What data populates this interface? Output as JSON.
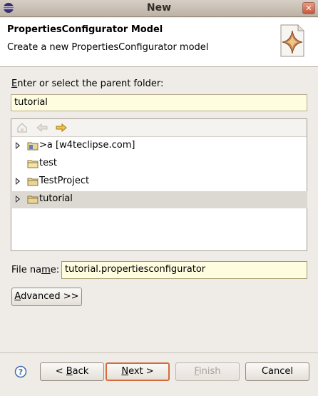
{
  "window": {
    "title": "New"
  },
  "header": {
    "title": "PropertiesConfigurator Model",
    "description": "Create a new PropertiesConfigurator model"
  },
  "parent_folder": {
    "label_mnemonic": "E",
    "label_rest": "nter or select the parent folder:",
    "value": "tutorial"
  },
  "tree": {
    "items": [
      {
        "label": ">a  [w4teclipse.com]",
        "expandable": true
      },
      {
        "label": "test",
        "expandable": false
      },
      {
        "label": "TestProject",
        "expandable": true
      },
      {
        "label": "tutorial",
        "expandable": true,
        "selected": true
      }
    ]
  },
  "file_name": {
    "label_pre": "File na",
    "label_mnemonic": "m",
    "label_post": "e:",
    "value": "tutorial.propertiesconfigurator"
  },
  "buttons": {
    "advanced_mnemonic": "A",
    "advanced_rest": "dvanced >>",
    "back_pre": "< ",
    "back_mnemonic": "B",
    "back_post": "ack",
    "next_mnemonic": "N",
    "next_post": "ext >",
    "finish_mnemonic": "F",
    "finish_post": "inish",
    "cancel": "Cancel"
  },
  "colors": {
    "input_bg": "#fffde0",
    "default_button_border": "#d46b3a",
    "selection_bg": "#dcd8d2"
  }
}
